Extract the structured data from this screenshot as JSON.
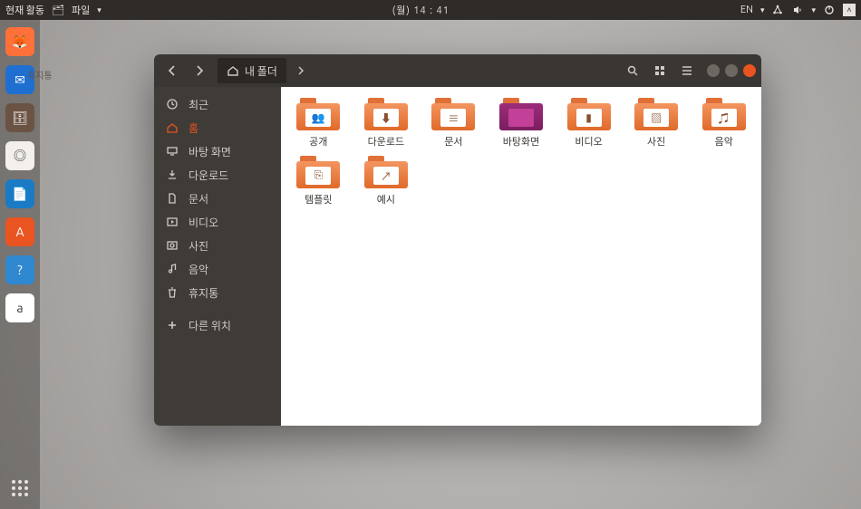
{
  "topbar": {
    "activities": "현재 활동",
    "app_indicator": "파일",
    "clock": "(월) 14 : 41",
    "input_lang": "EN"
  },
  "desktop": {
    "trash_label": "휴지통"
  },
  "dock": {
    "items": [
      {
        "name": "firefox",
        "glyph": "🦊",
        "bg": "#ff7139"
      },
      {
        "name": "thunderbird",
        "glyph": "✉",
        "bg": "#1f6fd0"
      },
      {
        "name": "files",
        "glyph": "🗄",
        "bg": "#6b5344"
      },
      {
        "name": "rhythmbox",
        "glyph": "◎",
        "bg": "#f2efec"
      },
      {
        "name": "writer",
        "glyph": "📄",
        "bg": "#1a7bc4"
      },
      {
        "name": "software",
        "glyph": "A",
        "bg": "#e95420"
      },
      {
        "name": "help",
        "glyph": "?",
        "bg": "#2f88d0"
      },
      {
        "name": "amazon",
        "glyph": "a",
        "bg": "#ffffff"
      }
    ]
  },
  "window": {
    "path_label": "내 폴더",
    "sidebar": [
      {
        "icon": "clock-icon",
        "label": "최근",
        "active": false
      },
      {
        "icon": "home-icon",
        "label": "홈",
        "active": true
      },
      {
        "icon": "desktop-icon",
        "label": "바탕 화면",
        "active": false
      },
      {
        "icon": "download-icon",
        "label": "다운로드",
        "active": false
      },
      {
        "icon": "document-icon",
        "label": "문서",
        "active": false
      },
      {
        "icon": "video-icon",
        "label": "비디오",
        "active": false
      },
      {
        "icon": "photo-icon",
        "label": "사진",
        "active": false
      },
      {
        "icon": "music-icon",
        "label": "음악",
        "active": false
      },
      {
        "icon": "trash-icon",
        "label": "휴지통",
        "active": false
      },
      {
        "icon": "plus-icon",
        "label": "다른 위치",
        "active": false
      }
    ],
    "folders": [
      {
        "label": "공개",
        "inner": "👥",
        "variant": ""
      },
      {
        "label": "다운로드",
        "inner": "⬇",
        "variant": ""
      },
      {
        "label": "문서",
        "inner": "≡",
        "variant": ""
      },
      {
        "label": "바탕화면",
        "inner": "",
        "variant": "pink"
      },
      {
        "label": "비디오",
        "inner": "▮",
        "variant": ""
      },
      {
        "label": "사진",
        "inner": "▧",
        "variant": ""
      },
      {
        "label": "음악",
        "inner": "♫",
        "variant": ""
      },
      {
        "label": "템플릿",
        "inner": "⎘",
        "variant": ""
      },
      {
        "label": "예시",
        "inner": "↗",
        "variant": ""
      }
    ]
  }
}
